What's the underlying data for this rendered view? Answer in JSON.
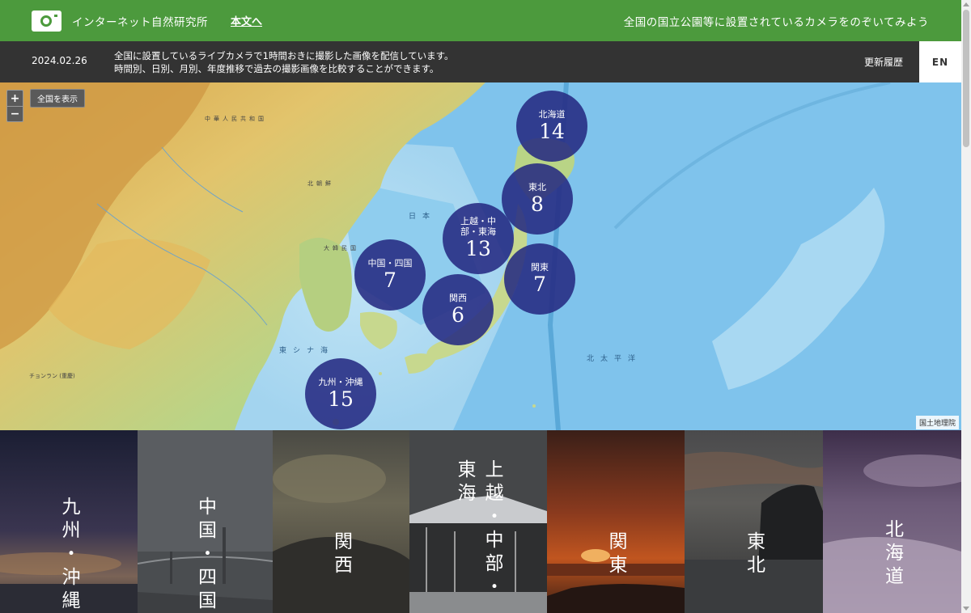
{
  "header": {
    "site_title": "インターネット自然研究所",
    "skip_link": "本文へ",
    "tagline": "全国の国立公園等に設置されているカメラをのぞいてみよう"
  },
  "infobar": {
    "date": "2024.02.26",
    "description_line1": "全国に設置しているライブカメラで1時間おきに撮影した画像を配信しています。",
    "description_line2": "時間別、日別、月別、年度推移で過去の撮影画像を比較することができます。",
    "history_link": "更新履歴",
    "language": "EN"
  },
  "map": {
    "zoom_in": "+",
    "zoom_out": "−",
    "show_all": "全国を表示",
    "attribution": "国土地理院",
    "labels": {
      "china": "中華人民共和国",
      "north_korea": "北朝鮮",
      "south_korea": "大韓民国",
      "sea_of_japan": "日本",
      "east_china_sea": "東シナ海",
      "pacific": "北太平洋",
      "city": "チョンラン (重慶)"
    },
    "clusters": [
      {
        "name": "北海道",
        "count": "14"
      },
      {
        "name": "東北",
        "count": "8"
      },
      {
        "name": "上越・中部・東海",
        "count": "13"
      },
      {
        "name": "中国・四国",
        "count": "7"
      },
      {
        "name": "関東",
        "count": "7"
      },
      {
        "name": "関西",
        "count": "6"
      },
      {
        "name": "九州・沖縄",
        "count": "15"
      }
    ]
  },
  "regions": [
    {
      "label": "九州・沖縄"
    },
    {
      "label": "中国・四国"
    },
    {
      "label": "関西"
    },
    {
      "label": "上越・中部・東海"
    },
    {
      "label": "関東"
    },
    {
      "label": "東北"
    },
    {
      "label": "北海道"
    }
  ],
  "colors": {
    "header_green": "#4c9a3d",
    "infobar_dark": "#333333",
    "cluster_navy": "#262a82",
    "sea_blue": "#7ec0ea"
  }
}
